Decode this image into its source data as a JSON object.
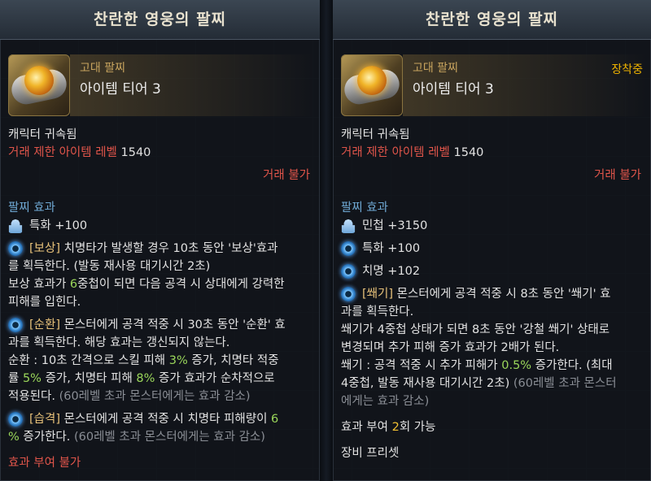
{
  "left": {
    "title": "찬란한 영웅의 팔찌",
    "grade": "고대 팔찌",
    "tier": "아이템 티어 3",
    "bind": "캐릭터 귀속됨",
    "trade_limit_label": "거래 제한 아이템 레벨",
    "trade_limit_value": "1540",
    "trade_status": "거래 불가",
    "effects_header": "팔찌 효과",
    "stat1": "특화 +100",
    "e1": {
      "tag": "[보상]",
      "l1": " 치명타가 발생할 경우 10초 동안 '보상'효과",
      "l2": "를 획득한다. (발동 재사용 대기시간 2초)",
      "l3a": "보상 효과가 ",
      "l3n": "6",
      "l3b": "중첩이 되면 다음 공격 시 상대에게 강력한",
      "l4": "피해를 입힌다."
    },
    "e2": {
      "tag": "[순환]",
      "l1": " 몬스터에게 공격 적중 시 30초 동안 '순환' 효",
      "l2": "과를 획득한다. 해당 효과는 갱신되지 않는다.",
      "l3a": "순환 : 10초 간격으로 스킬 피해 ",
      "l3n": "3%",
      "l3b": " 증가, 치명타 적중",
      "l4a": "률 ",
      "l4n1": "5%",
      "l4b": " 증가, 치명타 피해 ",
      "l4n2": "8%",
      "l4c": " 증가 효과가 순차적으로",
      "l5a": "적용된다. ",
      "l5g": "(60레벨 초과 몬스터에게는 효과 감소)"
    },
    "e3": {
      "tag": "[습격]",
      "l1a": " 몬스터에게 공격 적중 시 치명타 피해량이 ",
      "l1n": "6",
      "l2n": "%",
      "l2b": " 증가한다. ",
      "l2g": "(60레벨 초과 몬스터에게는 효과 감소)"
    },
    "footer": "효과 부여 불가"
  },
  "right": {
    "title": "찬란한 영웅의 팔찌",
    "grade": "고대 팔찌",
    "tier": "아이템 티어 3",
    "equipped": "장착중",
    "bind": "캐릭터 귀속됨",
    "trade_limit_label": "거래 제한 아이템 레벨",
    "trade_limit_value": "1540",
    "trade_status": "거래 불가",
    "effects_header": "팔찌 효과",
    "stat1": "민첩 +3150",
    "stat2": "특화 +100",
    "stat3": "치명 +102",
    "e1": {
      "tag": "[쐐기]",
      "l1": " 몬스터에게 공격 적중 시 8초 동안 '쐐기' 효",
      "l2": "과를 획득한다.",
      "l3": "쐐기가 4중첩 상태가 되면 8초 동안 '강철 쐐기' 상태로",
      "l4": "변경되며 추가 피해 증가 효과가 2배가 된다.",
      "l5a": "쐐기 : 공격 적중 시 추가 피해가 ",
      "l5n": "0.5%",
      "l5b": " 증가한다. (최대",
      "l6a": "4중첩, 발동 재사용 대기시간 2초) ",
      "l6g": "(60레벨 초과 몬스터",
      "l7g": "에게는 효과 감소)"
    },
    "enchant_a": "효과 부여 ",
    "enchant_n": "2",
    "enchant_b": "회 가능",
    "preset": "장비 프리셋"
  }
}
